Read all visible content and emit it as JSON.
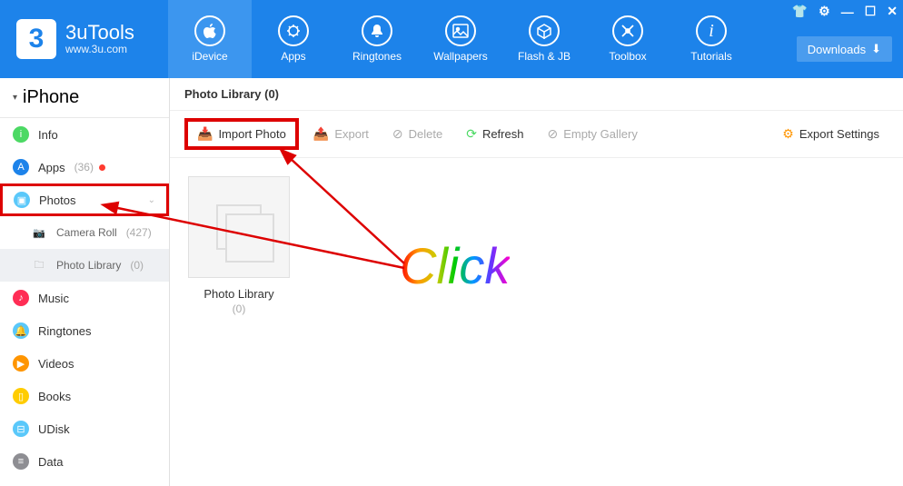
{
  "brand": {
    "name": "3uTools",
    "url": "www.3u.com"
  },
  "nav": {
    "idevice": "iDevice",
    "apps": "Apps",
    "ringtones": "Ringtones",
    "wallpapers": "Wallpapers",
    "flashjb": "Flash & JB",
    "toolbox": "Toolbox",
    "tutorials": "Tutorials"
  },
  "downloads_label": "Downloads",
  "device_name": "iPhone",
  "sidebar": {
    "info": "Info",
    "apps": "Apps",
    "apps_count": "(36)",
    "photos": "Photos",
    "camera_roll": "Camera Roll",
    "camera_roll_count": "(427)",
    "photo_library": "Photo Library",
    "photo_library_count": "(0)",
    "music": "Music",
    "ringtones": "Ringtones",
    "videos": "Videos",
    "books": "Books",
    "udisk": "UDisk",
    "data": "Data"
  },
  "content_title": "Photo Library (0)",
  "toolbar": {
    "import": "Import Photo",
    "export": "Export",
    "delete": "Delete",
    "refresh": "Refresh",
    "empty": "Empty Gallery",
    "settings": "Export Settings"
  },
  "album": {
    "name": "Photo Library",
    "count": "(0)"
  },
  "annotation": "Click"
}
